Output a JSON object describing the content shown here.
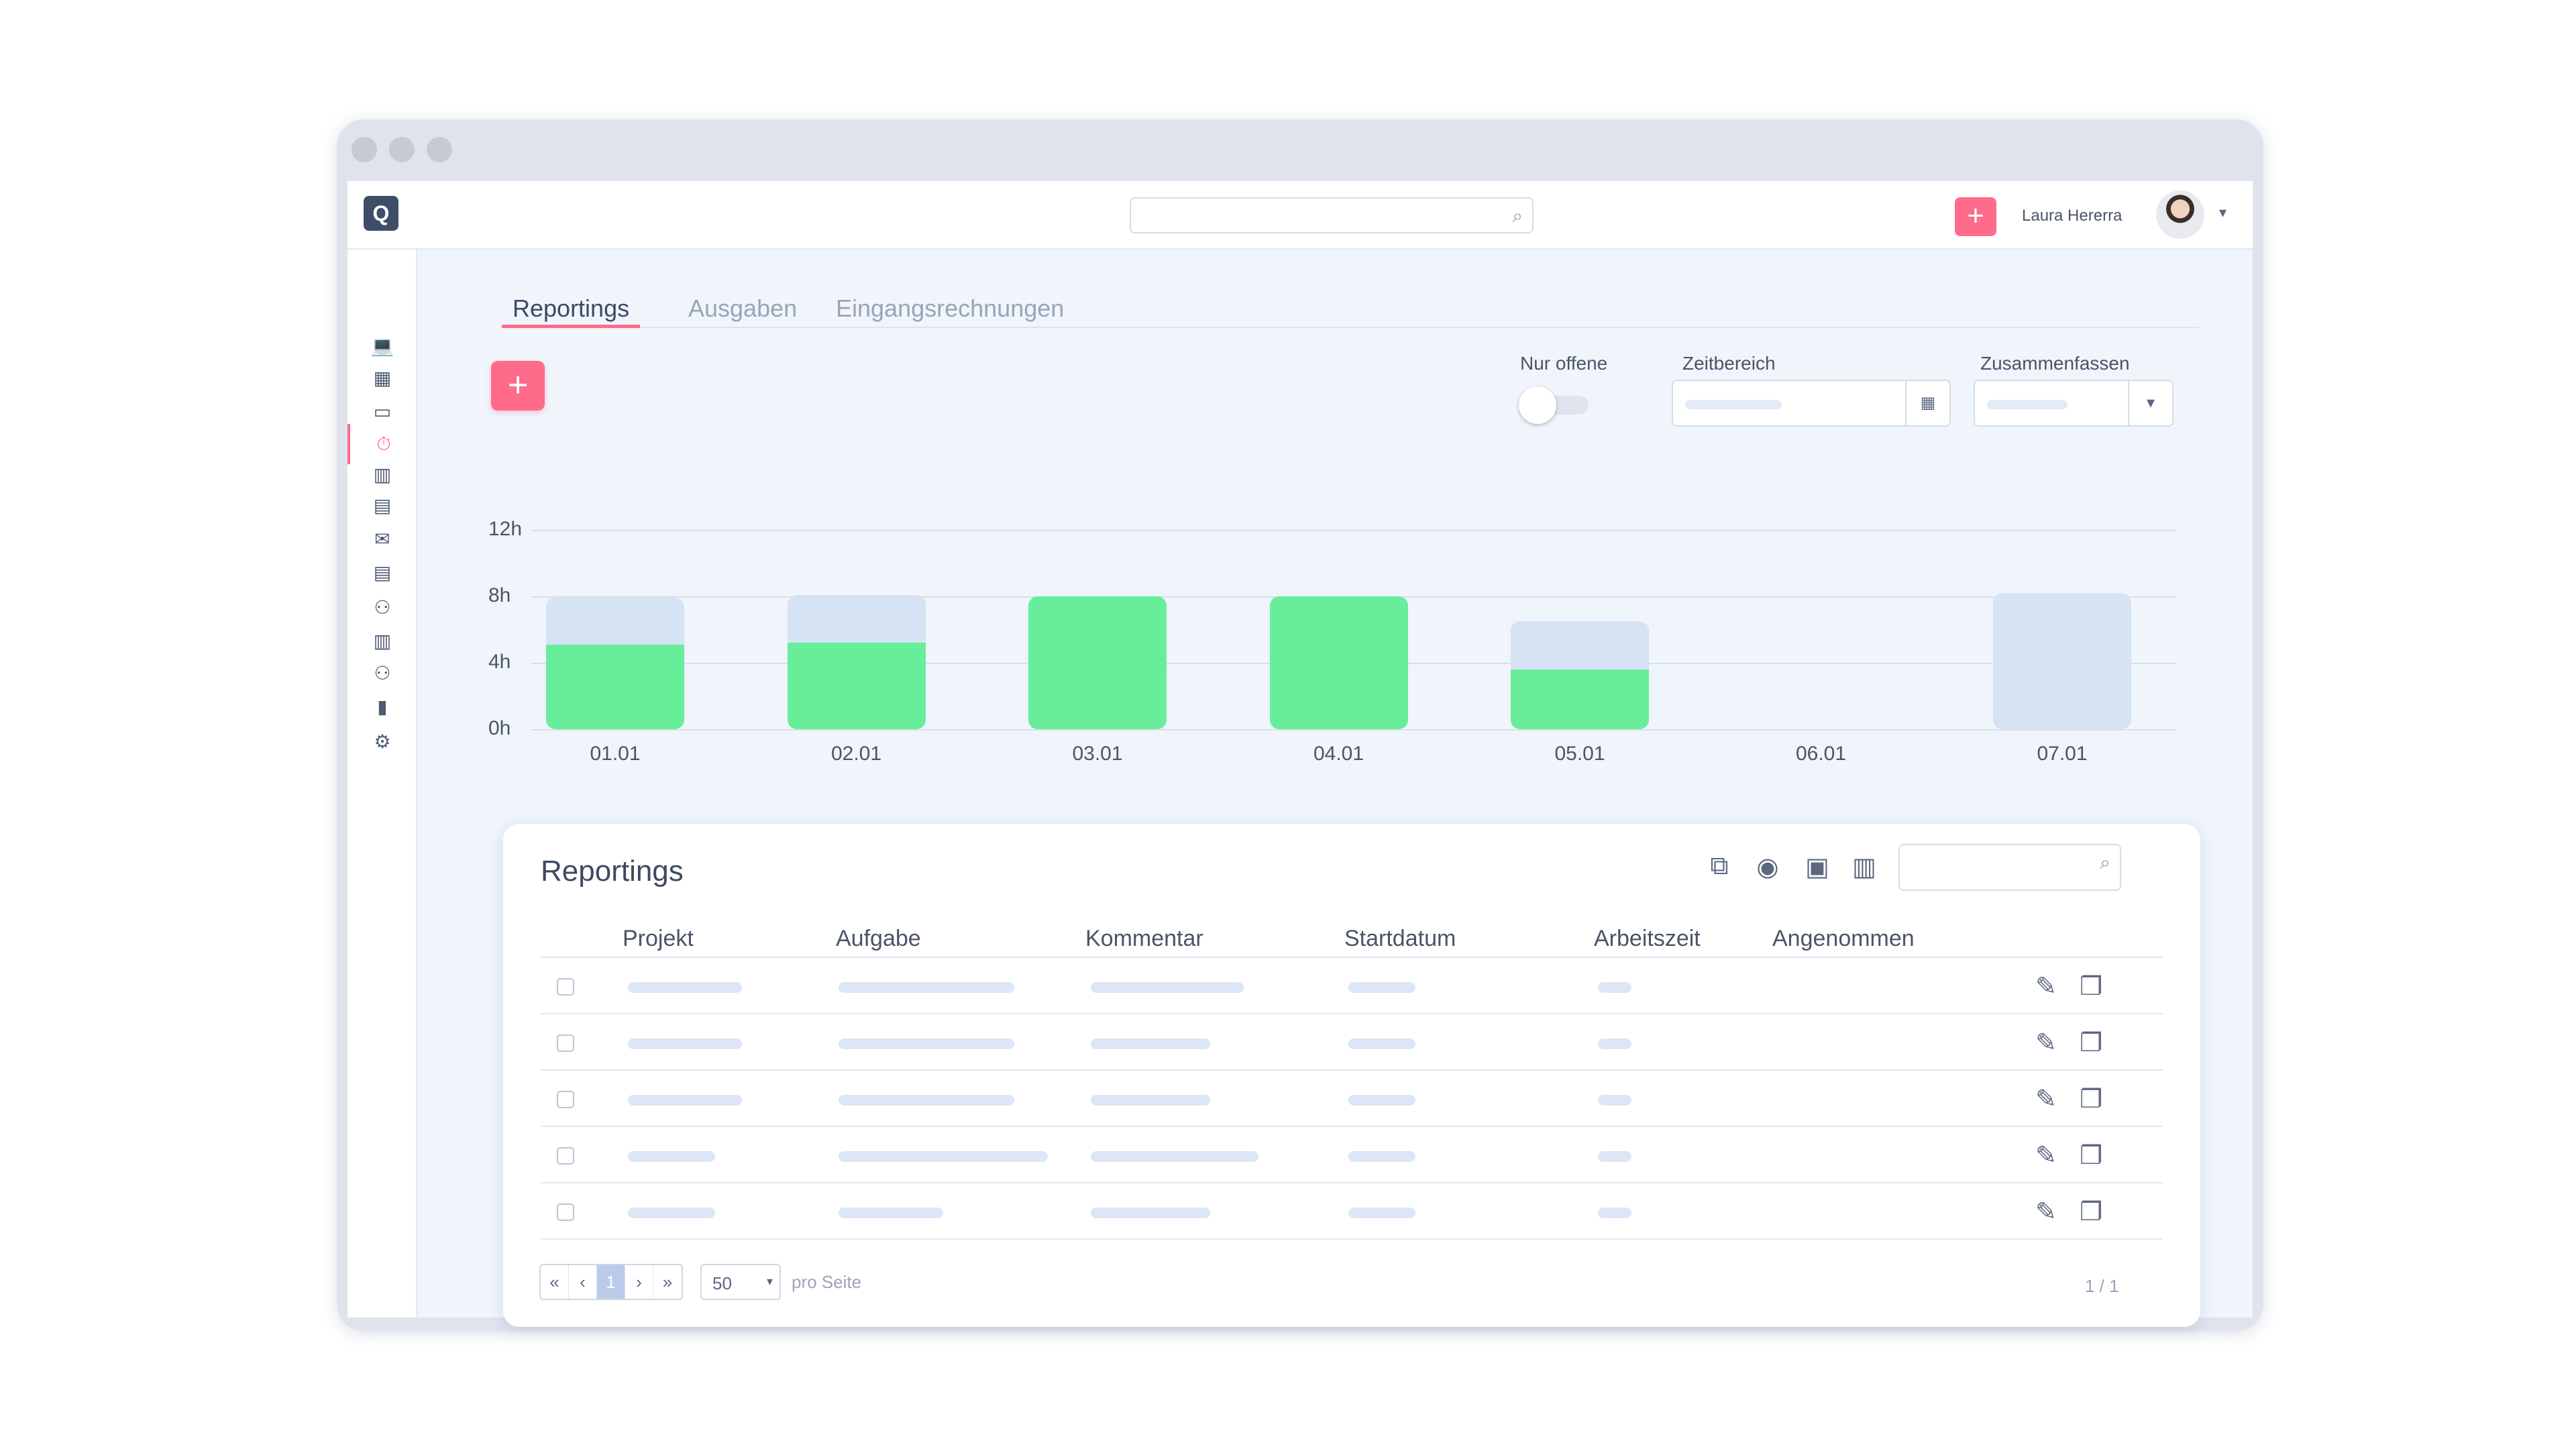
{
  "topbar": {
    "logo": "Q",
    "search_icon": "search-icon",
    "add_label": "+",
    "user_name": "Laura Hererra",
    "menu_caret": "▾"
  },
  "sidebar": {
    "items": [
      {
        "name": "laptop-icon",
        "glyph": "💻"
      },
      {
        "name": "dashboard-icon",
        "glyph": "▦"
      },
      {
        "name": "inbox-icon",
        "glyph": "▭"
      },
      {
        "name": "timer-icon",
        "glyph": "⏱",
        "active": true
      },
      {
        "name": "building-icon",
        "glyph": "▥"
      },
      {
        "name": "documents-icon",
        "glyph": "▤"
      },
      {
        "name": "mail-check-icon",
        "glyph": "✉"
      },
      {
        "name": "list-icon",
        "glyph": "▤"
      },
      {
        "name": "add-user-icon",
        "glyph": "⚇"
      },
      {
        "name": "company-icon",
        "glyph": "▥"
      },
      {
        "name": "people-icon",
        "glyph": "⚇"
      },
      {
        "name": "chart-icon",
        "glyph": "▮"
      },
      {
        "name": "settings-icon",
        "glyph": "⚙"
      }
    ]
  },
  "tabs": [
    "Reportings",
    "Ausgaben",
    "Eingangsrechnungen"
  ],
  "filters": {
    "add_label": "+",
    "only_open_label": "Nur offene",
    "only_open_on": false,
    "time_range_label": "Zeitbereich",
    "summarize_label": "Zusammenfassen"
  },
  "chart_data": {
    "type": "bar",
    "categories": [
      "01.01",
      "02.01",
      "03.01",
      "04.01",
      "05.01",
      "06.01",
      "07.01"
    ],
    "series": [
      {
        "values": [
          5.1,
          5.2,
          8,
          8,
          3.6,
          0,
          0
        ],
        "color": "#68ee9a"
      },
      {
        "values": [
          2.8,
          2.9,
          0,
          0,
          2.9,
          0,
          8.2
        ],
        "color": "#d6e3f5"
      }
    ],
    "ytick_labels": [
      "12h",
      "8h",
      "4h",
      "0h"
    ],
    "ylim": [
      0,
      12
    ],
    "stacked": true
  },
  "table": {
    "title": "Reportings",
    "tools": [
      "external-link-icon",
      "record-icon",
      "save-icon",
      "trash-icon"
    ],
    "columns": [
      "Projekt",
      "Aufgabe",
      "Kommentar",
      "Startdatum",
      "Arbeitszeit",
      "Angenommen"
    ],
    "row_count": 5,
    "row_icons": [
      "✎",
      "❐"
    ]
  },
  "pagination": {
    "first": "«",
    "prev": "‹",
    "current": "1",
    "next": "›",
    "last": "»",
    "per_page": "50",
    "per_page_label": "pro Seite",
    "page_info": "1 / 1"
  }
}
